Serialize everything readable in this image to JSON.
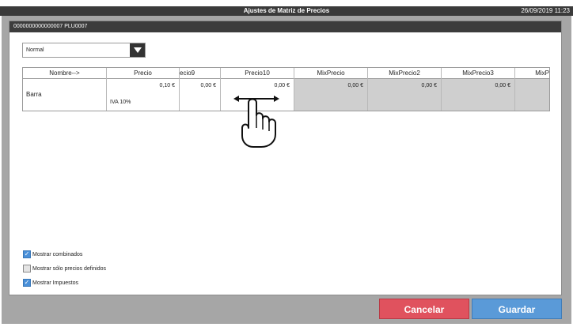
{
  "window": {
    "title": "Ajustes de Matriz de Precios",
    "clock": "26/09/2019 11:23"
  },
  "panel": {
    "header": "0000000000000007 PLU0007"
  },
  "select": {
    "value": "Normal"
  },
  "grid": {
    "headers": [
      "Nombre-->",
      "Precio",
      "ecio9",
      "Precio10",
      "MixPrecio",
      "MixPrecio2",
      "MixPrecio3",
      "MixP"
    ],
    "row": {
      "name": "Barra",
      "precio": "0,10 €",
      "tax": "IVA 10%",
      "precio9": "0,00 €",
      "precio10": "0,00 €",
      "mix1": "0,00 €",
      "mix2": "0,00 €",
      "mix3": "0,00 €"
    }
  },
  "options": {
    "combinados": "Mostrar combinados",
    "definidos": "Mostrar sólo precios definidos",
    "impuestos": "Mostrar Impuestos"
  },
  "buttons": {
    "cancel": "Cancelar",
    "save": "Guardar"
  },
  "colors": {
    "cancel": "#e0525e",
    "save": "#5a9ad8",
    "checked": "#4a90d9"
  },
  "icons": {
    "gesture": "swipe-horizontal-hand-icon",
    "dropdown": "chevron-down-icon"
  }
}
